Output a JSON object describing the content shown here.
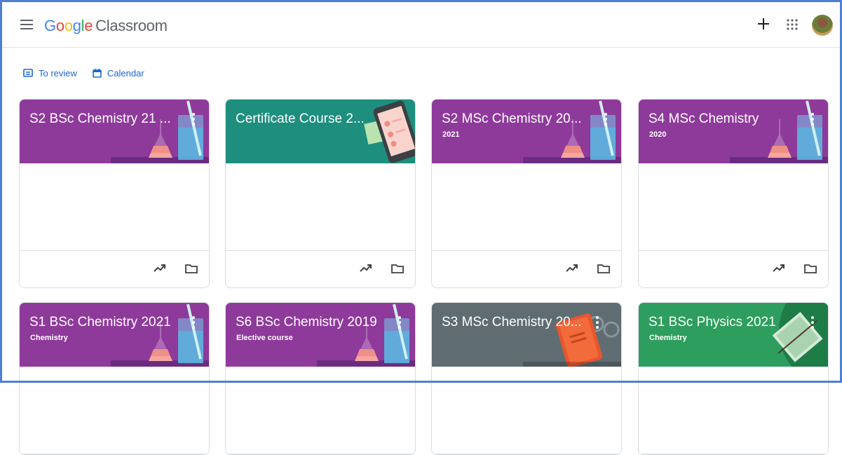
{
  "app": {
    "logo": {
      "G": "G",
      "o1": "o",
      "o2": "o",
      "g": "g",
      "l": "l",
      "e": "e",
      "product": "Classroom"
    }
  },
  "subnav": {
    "to_review": "To review",
    "calendar": "Calendar"
  },
  "cards": [
    {
      "title": "S2 BSc Chemistry 21 ...",
      "subtitle": "",
      "color": "#8e3a9b",
      "art": "chemistry"
    },
    {
      "title": "Certificate Course 2...",
      "subtitle": "",
      "color": "#1e8e7e",
      "art": "phone"
    },
    {
      "title": "S2 MSc Chemistry 20...",
      "subtitle": "2021",
      "color": "#8e3a9b",
      "art": "chemistry"
    },
    {
      "title": "S4 MSc Chemistry",
      "subtitle": "2020",
      "color": "#8e3a9b",
      "art": "chemistry"
    },
    {
      "title": "S1 BSc Chemistry 2021",
      "subtitle": "Chemistry",
      "color": "#8e3a9b",
      "art": "chemistry"
    },
    {
      "title": "S6 BSc Chemistry 2019",
      "subtitle": "Elective course",
      "color": "#8e3a9b",
      "art": "chemistry"
    },
    {
      "title": "S3 MSc Chemistry 20...",
      "subtitle": "",
      "color": "#5f6d73",
      "art": "book"
    },
    {
      "title": "S1 BSc Physics 2021",
      "subtitle": "Chemistry",
      "color": "#2e9e5e",
      "art": "physics"
    }
  ],
  "icons": {
    "menu": "menu-icon",
    "plus": "plus-icon",
    "apps": "apps-grid-icon",
    "avatar": "avatar",
    "to_review": "assignment-icon",
    "calendar": "calendar-icon",
    "card_more": "more-vert-icon",
    "progress": "trending-up-icon",
    "folder": "folder-icon"
  }
}
